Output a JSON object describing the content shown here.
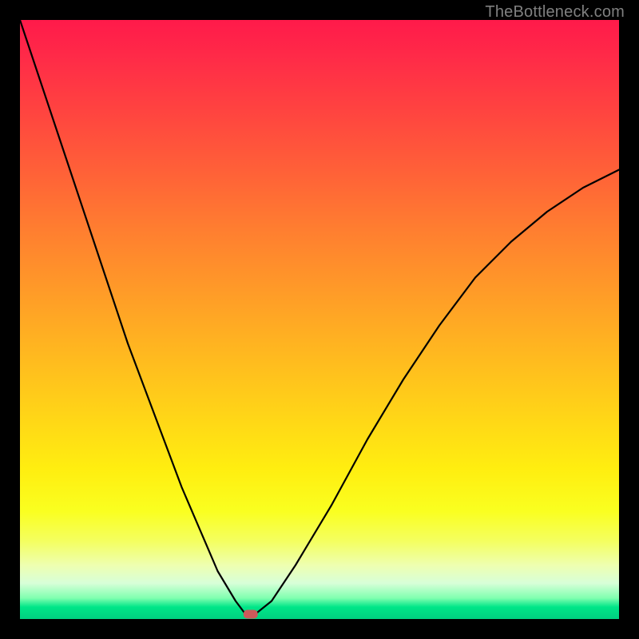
{
  "watermark": "TheBottleneck.com",
  "chart_data": {
    "type": "line",
    "title": "",
    "xlabel": "",
    "ylabel": "",
    "xlim": [
      0,
      100
    ],
    "ylim": [
      0,
      100
    ],
    "grid": false,
    "legend": false,
    "background": {
      "type": "vertical-gradient",
      "stops": [
        {
          "pos": 0,
          "color": "#ff1a4a"
        },
        {
          "pos": 50,
          "color": "#ffb020"
        },
        {
          "pos": 80,
          "color": "#fff030"
        },
        {
          "pos": 100,
          "color": "#00d080"
        }
      ],
      "meaning": "red_high_bottleneck_green_low_bottleneck"
    },
    "series": [
      {
        "name": "bottleneck-curve",
        "x": [
          0,
          3,
          6,
          9,
          12,
          15,
          18,
          21,
          24,
          27,
          30,
          33,
          36,
          37.5,
          39.5,
          42,
          46,
          52,
          58,
          64,
          70,
          76,
          82,
          88,
          94,
          100
        ],
        "y": [
          100,
          91,
          82,
          73,
          64,
          55,
          46,
          38,
          30,
          22,
          15,
          8,
          3,
          1,
          1,
          3,
          9,
          19,
          30,
          40,
          49,
          57,
          63,
          68,
          72,
          75
        ]
      }
    ],
    "marker": {
      "name": "optimal-point",
      "x": 38.5,
      "y": 0.8,
      "shape": "rounded-rect",
      "color": "#cc5a5a"
    }
  }
}
